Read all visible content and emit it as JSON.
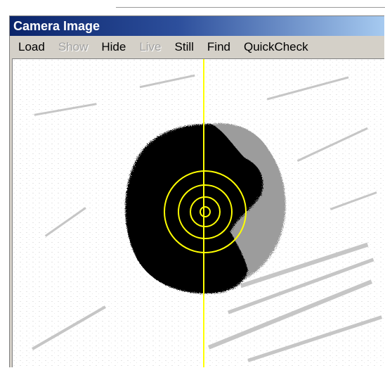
{
  "window": {
    "title": "Camera Image"
  },
  "menu": {
    "items": [
      {
        "label": "Load",
        "enabled": true
      },
      {
        "label": "Show",
        "enabled": false
      },
      {
        "label": "Hide",
        "enabled": true
      },
      {
        "label": "Live",
        "enabled": false
      },
      {
        "label": "Still",
        "enabled": true
      },
      {
        "label": "Find",
        "enabled": true
      },
      {
        "label": "QuickCheck",
        "enabled": true
      }
    ]
  },
  "colors": {
    "title_gradient_start": "#0a246a",
    "title_gradient_end": "#a6caf0",
    "menu_background": "#d4d0c8",
    "disabled_text": "#a0a0a0",
    "crosshair": "#ffff00",
    "target_dark": "#000000",
    "target_shadow": "#999999",
    "noise": "#b4b4b4"
  },
  "icons": {
    "targeting_rings": "concentric-circles-icon",
    "crosshair": "vertical-line-icon"
  }
}
